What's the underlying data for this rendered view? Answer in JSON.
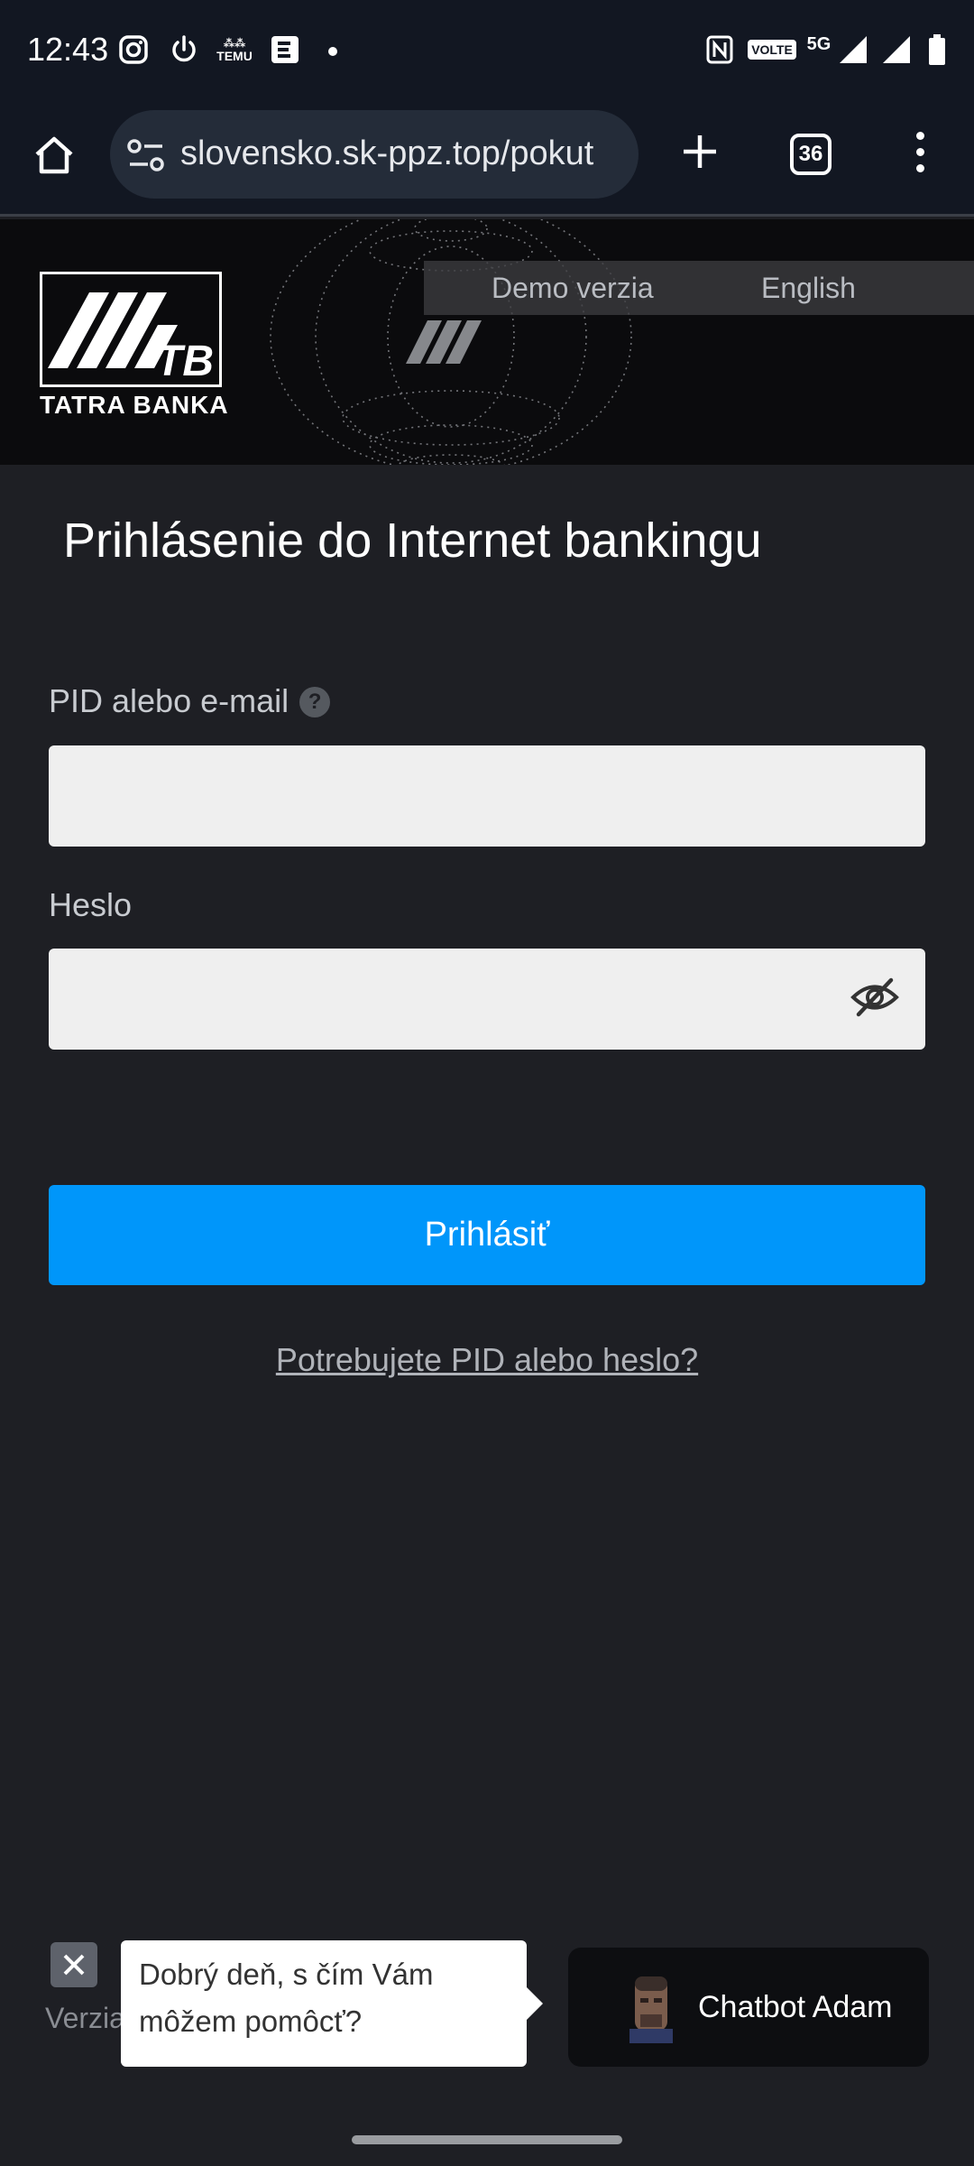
{
  "status_bar": {
    "time": "12:43",
    "icons": [
      "instagram-icon",
      "power-icon",
      "temu-icon",
      "e-app-icon",
      "dot-icon",
      "nfc-icon",
      "volte-icon",
      "5g-icon",
      "signal-icon",
      "signal-icon",
      "battery-icon"
    ],
    "volte_label": "VOLTE",
    "network_label": "5G",
    "temu_label": "TEMU"
  },
  "browser": {
    "url": "slovensko.sk-ppz.top/pokut",
    "tab_count": "36"
  },
  "header": {
    "logo_text": "TATRA BANKA",
    "logo_mark": "TB",
    "lang_demo": "Demo verzia",
    "lang_english": "English"
  },
  "form": {
    "title": "Prihlásenie do Internet bankingu",
    "pid_label": "PID alebo e-mail",
    "pid_help": "?",
    "pid_value": "",
    "password_label": "Heslo",
    "password_value": "",
    "submit_label": "Prihlásiť",
    "help_link": "Potrebujete PID alebo heslo?"
  },
  "chat": {
    "version_label": "Verzia",
    "bubble_text": "Dobrý deň, s čím Vám môžem pomôcť?",
    "bot_name": "Chatbot Adam"
  },
  "colors": {
    "background": "#1e1f24",
    "toolbar": "#121722",
    "primary_button": "#0096fa",
    "input_bg": "#efefef"
  }
}
